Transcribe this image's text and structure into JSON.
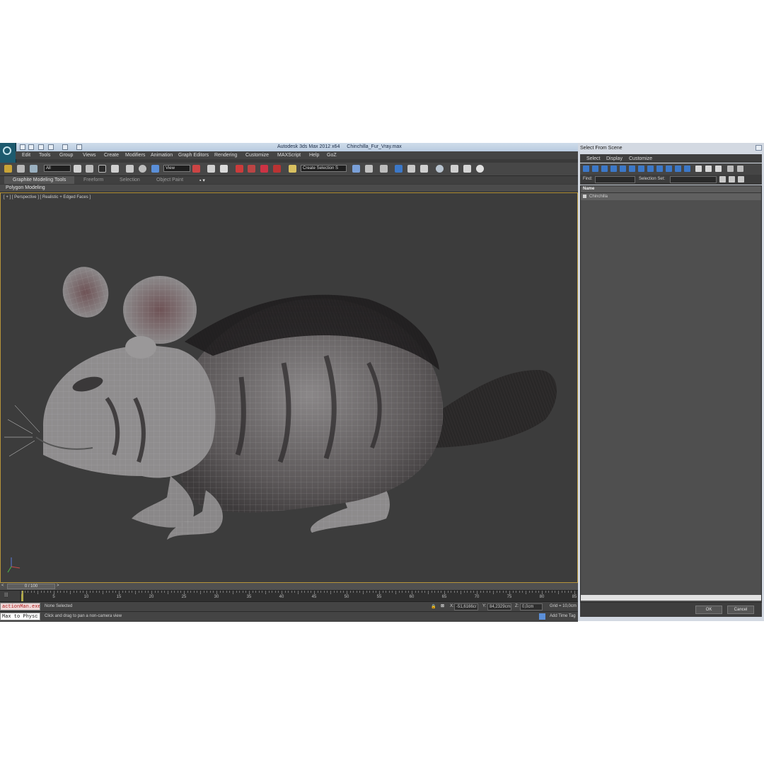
{
  "app": {
    "title": "Autodesk 3ds Max 2012 x64",
    "file": "Chinchilla_Fur_Vray.max"
  },
  "menubar": [
    "Edit",
    "Tools",
    "Group",
    "Views",
    "Create",
    "Modifiers",
    "Animation",
    "Graph Editors",
    "Rendering",
    "Customize",
    "MAXScript",
    "Help",
    "GoZ"
  ],
  "toolbar": {
    "selection_filter": "All",
    "reference_coord": "View",
    "named_selection": "Create Selection S"
  },
  "ribbon": {
    "tabs": [
      "Graphite Modeling Tools",
      "Freeform",
      "Selection",
      "Object Paint"
    ],
    "panel": "Polygon Modeling"
  },
  "viewport": {
    "label": "[ + ] [ Perspective ] [ Realistic + Edged Faces ]",
    "object": "chinchilla-fur-model"
  },
  "timeline": {
    "frame": "0 / 100",
    "ticks": [
      "5",
      "10",
      "15",
      "20",
      "25",
      "30",
      "35",
      "40",
      "45",
      "50",
      "55",
      "60",
      "65",
      "70",
      "75",
      "80",
      "85"
    ]
  },
  "status": {
    "maxscript_line1": "actionMan.exe",
    "maxscript_line2": "Max to Physc",
    "selection": "None Selected",
    "prompt": "Click and drag to pan a non-camera view",
    "x_label": "X:",
    "x": "-51,6166cr",
    "y_label": "Y:",
    "y": "84,2329cm",
    "z_label": "Z:",
    "z": "0,0cm",
    "grid": "Grid = 10,0cm",
    "add_time_tag": "Add Time Tag"
  },
  "dialog": {
    "title": "Select From Scene",
    "menu": [
      "Select",
      "Display",
      "Customize"
    ],
    "find_label": "Find:",
    "selection_set_label": "Selection Set:",
    "column_header": "Name",
    "items": [
      "Chinchilla"
    ],
    "ok": "OK",
    "cancel": "Cancel"
  },
  "colors": {
    "accent_blue": "#3c78c8",
    "viewport_border": "#b6943a",
    "viewport_bg": "#3c3c3c"
  }
}
